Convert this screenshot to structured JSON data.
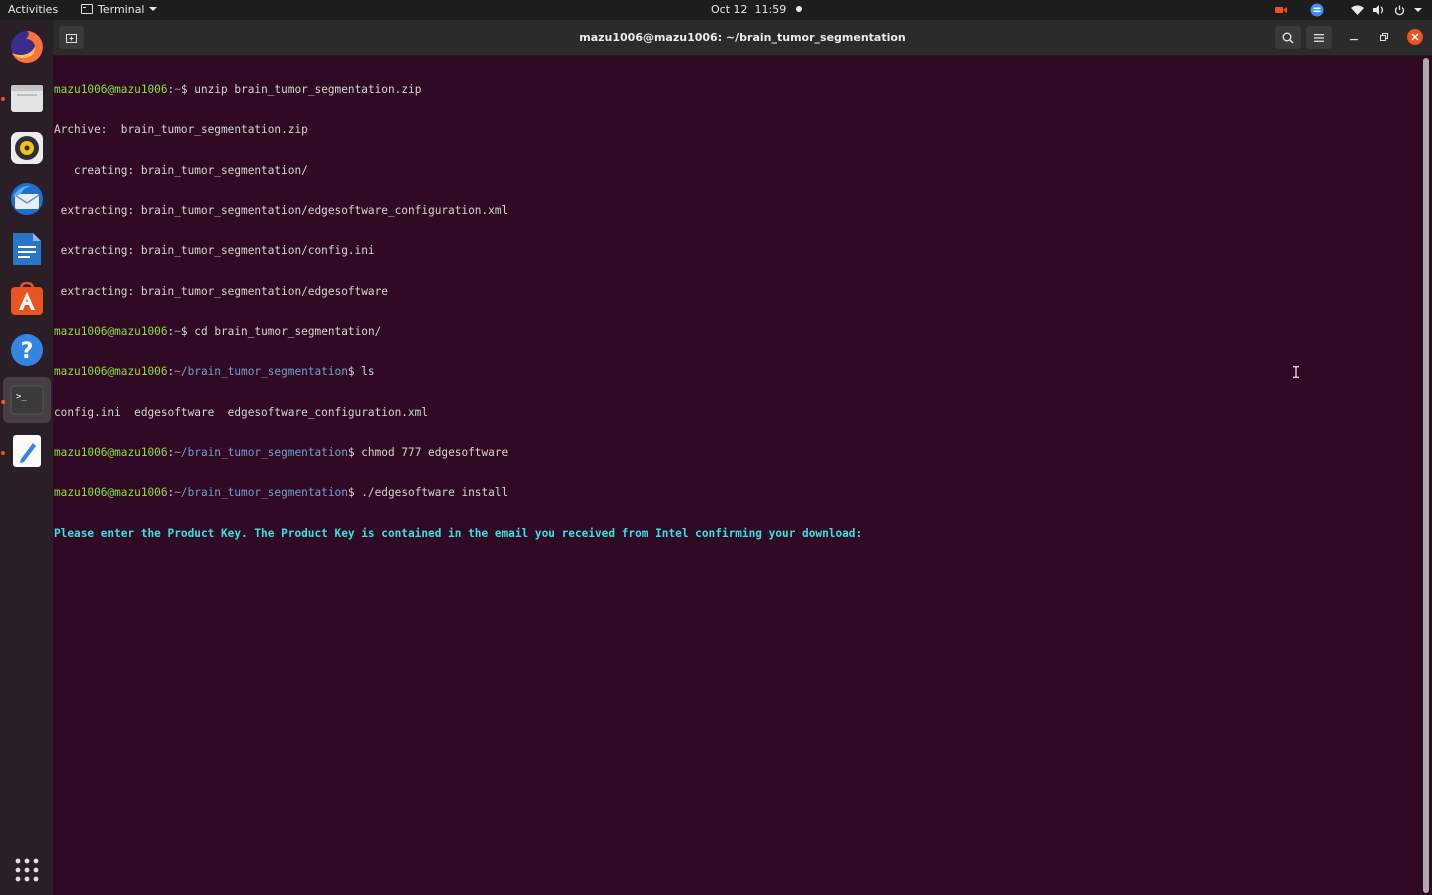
{
  "topbar": {
    "activities": "Activities",
    "app_menu": "Terminal",
    "date": "Oct 12",
    "time": "11:59",
    "tray_icons": [
      "camera-icon",
      "chat-icon",
      "wifi-icon",
      "volume-icon",
      "power-icon",
      "chevron-down-icon"
    ]
  },
  "dock": {
    "items": [
      "Firefox",
      "Files",
      "Rhythmbox",
      "Thunderbird",
      "LibreOffice Writer",
      "Ubuntu Software",
      "Help",
      "Terminal",
      "Text Editor"
    ],
    "show_apps": "show-apps-icon"
  },
  "window": {
    "title": "mazu1006@mazu1006: ~/brain_tumor_segmentation"
  },
  "terminal": {
    "lines": [
      {
        "user": "mazu1006@mazu1006",
        "path": "~",
        "cmd": " unzip brain_tumor_segmentation.zip"
      },
      {
        "text": "Archive:  brain_tumor_segmentation.zip"
      },
      {
        "text": "   creating: brain_tumor_segmentation/"
      },
      {
        "text": " extracting: brain_tumor_segmentation/edgesoftware_configuration.xml"
      },
      {
        "text": " extracting: brain_tumor_segmentation/config.ini"
      },
      {
        "text": " extracting: brain_tumor_segmentation/edgesoftware"
      },
      {
        "user": "mazu1006@mazu1006",
        "path": "~",
        "cmd": " cd brain_tumor_segmentation/"
      },
      {
        "user": "mazu1006@mazu1006",
        "path": "~/brain_tumor_segmentation",
        "cmd": " ls"
      },
      {
        "text": "config.ini  edgesoftware  edgesoftware_configuration.xml"
      },
      {
        "user": "mazu1006@mazu1006",
        "path": "~/brain_tumor_segmentation",
        "cmd": " chmod 777 edgesoftware"
      },
      {
        "user": "mazu1006@mazu1006",
        "path": "~/brain_tumor_segmentation",
        "cmd": " ./edgesoftware install"
      },
      {
        "highlight": "Please enter the Product Key. The Product Key is contained in the email you received from Intel confirming your download:"
      }
    ]
  },
  "colors": {
    "terminal_bg": "#300a24",
    "prompt_user": "#8ae234",
    "prompt_path": "#729fcf",
    "prompt_highlight": "#34e2e2",
    "accent": "#e95420"
  }
}
